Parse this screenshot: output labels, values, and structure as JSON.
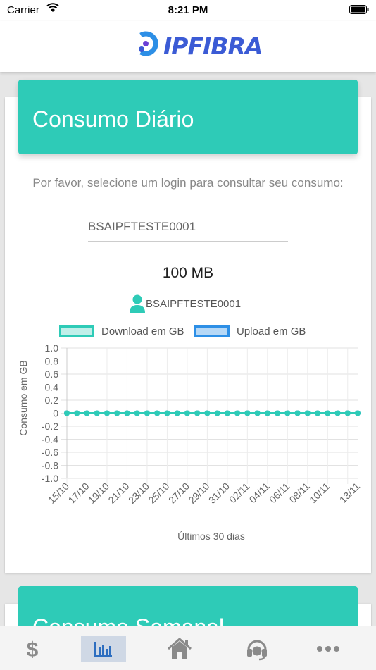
{
  "status_bar": {
    "carrier": "Carrier",
    "time": "8:21 PM"
  },
  "header": {
    "logo_text": "IPFIBRA",
    "brand_color": "#3b5bd5"
  },
  "card": {
    "title": "Consumo Diário",
    "instruction": "Por favor, selecione um login para consultar seu consumo:",
    "login_value": "BSAIPFTESTE0001",
    "plan": "100 MB",
    "user_name": "BSAIPFTESTE0001",
    "accent_color": "#2ecbb7"
  },
  "chart_data": {
    "type": "line",
    "title": "",
    "xlabel": "Últimos 30 dias",
    "ylabel": "Consumo em GB",
    "ylim": [
      -1.0,
      1.0
    ],
    "y_ticks": [
      "1.0",
      "0.8",
      "0.6",
      "0.4",
      "0.2",
      "0",
      "-0.2",
      "-0.4",
      "-0.6",
      "-0.8",
      "-1.0"
    ],
    "x_tick_labels": [
      "15/10",
      "17/10",
      "19/10",
      "21/10",
      "23/10",
      "25/10",
      "27/10",
      "29/10",
      "31/10",
      "02/11",
      "04/11",
      "06/11",
      "08/11",
      "10/11",
      "13/11"
    ],
    "x": [
      "15/10",
      "16/10",
      "17/10",
      "18/10",
      "19/10",
      "20/10",
      "21/10",
      "22/10",
      "23/10",
      "24/10",
      "25/10",
      "26/10",
      "27/10",
      "28/10",
      "29/10",
      "30/10",
      "31/10",
      "01/11",
      "02/11",
      "03/11",
      "04/11",
      "05/11",
      "06/11",
      "07/11",
      "08/11",
      "09/11",
      "10/11",
      "11/11",
      "12/11",
      "13/11"
    ],
    "series": [
      {
        "name": "Download em GB",
        "color": "#2ecbb7",
        "values": [
          0,
          0,
          0,
          0,
          0,
          0,
          0,
          0,
          0,
          0,
          0,
          0,
          0,
          0,
          0,
          0,
          0,
          0,
          0,
          0,
          0,
          0,
          0,
          0,
          0,
          0,
          0,
          0,
          0,
          0
        ]
      },
      {
        "name": "Upload em GB",
        "color": "#2d8fe6",
        "values": [
          0,
          0,
          0,
          0,
          0,
          0,
          0,
          0,
          0,
          0,
          0,
          0,
          0,
          0,
          0,
          0,
          0,
          0,
          0,
          0,
          0,
          0,
          0,
          0,
          0,
          0,
          0,
          0,
          0,
          0
        ]
      }
    ],
    "grid": true,
    "legend": "top-center"
  },
  "second_card": {
    "title": "Consumo Semanal"
  },
  "tabs": [
    {
      "name": "billing",
      "icon": "dollar-icon",
      "active": false
    },
    {
      "name": "consumption",
      "icon": "bar-chart-icon",
      "active": true
    },
    {
      "name": "home",
      "icon": "home-icon",
      "active": false
    },
    {
      "name": "support",
      "icon": "headset-icon",
      "active": false
    },
    {
      "name": "more",
      "icon": "more-icon",
      "active": false
    }
  ]
}
